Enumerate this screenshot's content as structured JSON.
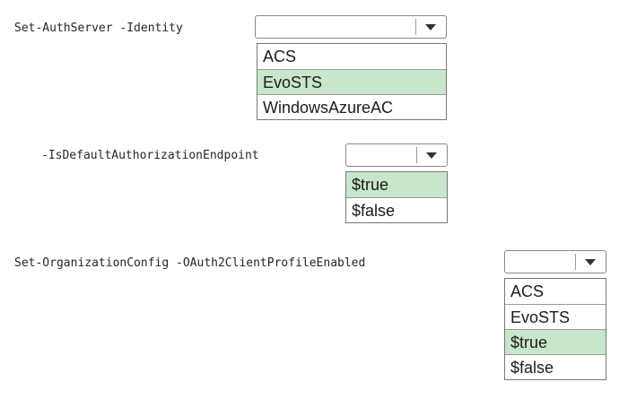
{
  "rows": [
    {
      "label": "Set-AuthServer -Identity",
      "selected_value": "",
      "options": [
        {
          "text": "ACS",
          "selected": false
        },
        {
          "text": "EvoSTS",
          "selected": true
        },
        {
          "text": "WindowsAzureAC",
          "selected": false
        }
      ]
    },
    {
      "label": "-IsDefaultAuthorizationEndpoint",
      "selected_value": "",
      "options": [
        {
          "text": "$true",
          "selected": true
        },
        {
          "text": "$false",
          "selected": false
        }
      ]
    },
    {
      "label": "Set-OrganizationConfig -OAuth2ClientProfileEnabled",
      "selected_value": "",
      "options": [
        {
          "text": "ACS",
          "selected": false
        },
        {
          "text": "EvoSTS",
          "selected": false
        },
        {
          "text": "$true",
          "selected": true
        },
        {
          "text": "$false",
          "selected": false
        }
      ]
    }
  ],
  "icons": {
    "dropdown_arrow": "chevron-down-icon"
  },
  "colors": {
    "highlight": "#c8e6c9",
    "border": "#777777"
  }
}
